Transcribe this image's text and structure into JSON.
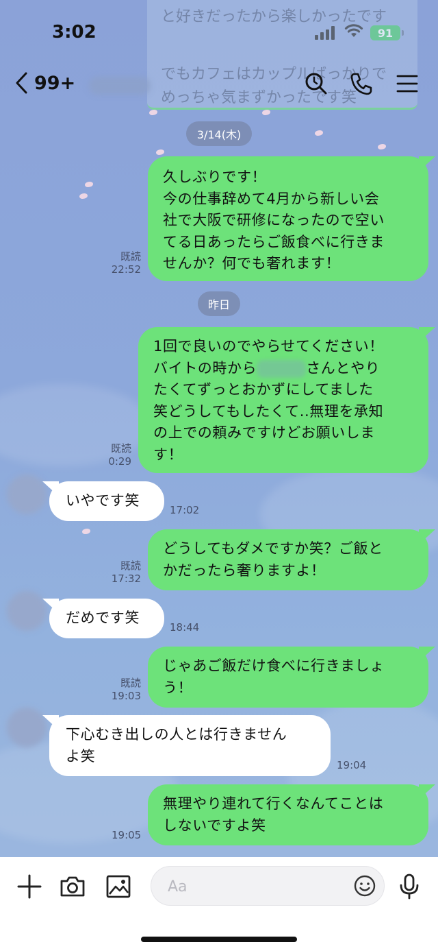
{
  "status": {
    "time": "3:02",
    "battery": "91"
  },
  "header": {
    "back_count": "99+",
    "pinned_preview_lines": [
      "と好きだったから楽しかったです",
      "でもカフェはカップルばっかりで",
      "めっちゃ気まずかったです笑"
    ]
  },
  "dates": {
    "first": "3/14(木)",
    "second": "昨日"
  },
  "messages": {
    "m1": {
      "lines": [
        "久しぶりです！",
        "今の仕事辞めて4月から新しい会",
        "社で大阪で研修になったので空い",
        "てる日あったらご飯食べに行きま",
        "せんか？何でも奢れます！"
      ],
      "read": "既読",
      "time": "22:52"
    },
    "m2": {
      "line1": "1回で良いのでやらせてください！",
      "line2_pre": "バイトの時から",
      "line2_post": "さんとやり",
      "line3": "たくてずっとおかずにしてました",
      "line4": "笑どうしてもしたくて..無理を承知",
      "line5": "の上での頼みですけどお願いしま",
      "line6": "す！",
      "read": "既読",
      "time": "0:29"
    },
    "m3": {
      "text": "いやです笑",
      "time": "17:02"
    },
    "m4": {
      "lines": [
        "どうしてもダメですか笑？ご飯と",
        "かだったら奢りますよ！"
      ],
      "read": "既読",
      "time": "17:32"
    },
    "m5": {
      "text": "だめです笑",
      "time": "18:44"
    },
    "m6": {
      "lines": [
        "じゃあご飯だけ食べに行きましょ",
        "う！"
      ],
      "read": "既読",
      "time": "19:03"
    },
    "m7": {
      "lines": [
        "下心むき出しの人とは行きません",
        "よ笑"
      ],
      "time": "19:04"
    },
    "m8": {
      "lines": [
        "無理やり連れて行くなんてことは",
        "しないですよ笑"
      ],
      "time": "19:05"
    }
  },
  "input": {
    "placeholder": "Aa"
  },
  "colors": {
    "outgoing_bubble": "#6de27a",
    "incoming_bubble": "#ffffff",
    "background": "#8aa3d6"
  }
}
